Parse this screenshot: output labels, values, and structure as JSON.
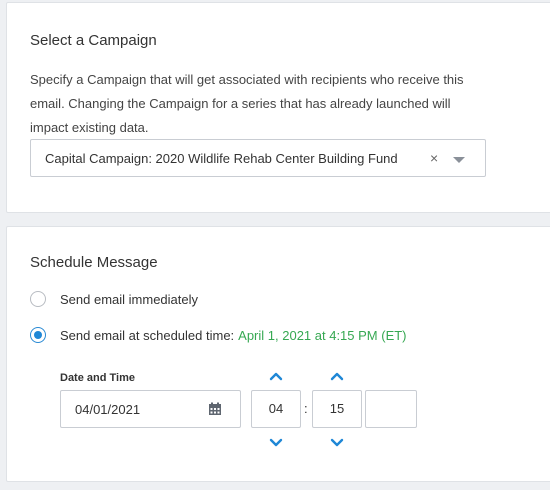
{
  "campaign": {
    "title": "Select a Campaign",
    "description": "Specify a Campaign that will get associated with recipients who receive this email. Changing the Campaign for a series that has already launched will impact existing data.",
    "selected": "Capital Campaign: 2020 Wildlife Rehab Center Building Fund",
    "clear_glyph": "×"
  },
  "schedule": {
    "title": "Schedule Message",
    "option_immediate": "Send email immediately",
    "option_scheduled": "Send email at scheduled time:",
    "scheduled_time": "April 1, 2021 at 4:15 PM (ET)",
    "selected_option": "scheduled",
    "date_time_label": "Date and Time",
    "date": "04/01/2021",
    "hour": "04",
    "separator": ":",
    "minute": "15",
    "ampm": ""
  },
  "colors": {
    "accent": "#1f87d6",
    "scheduled_text": "#36a852"
  }
}
